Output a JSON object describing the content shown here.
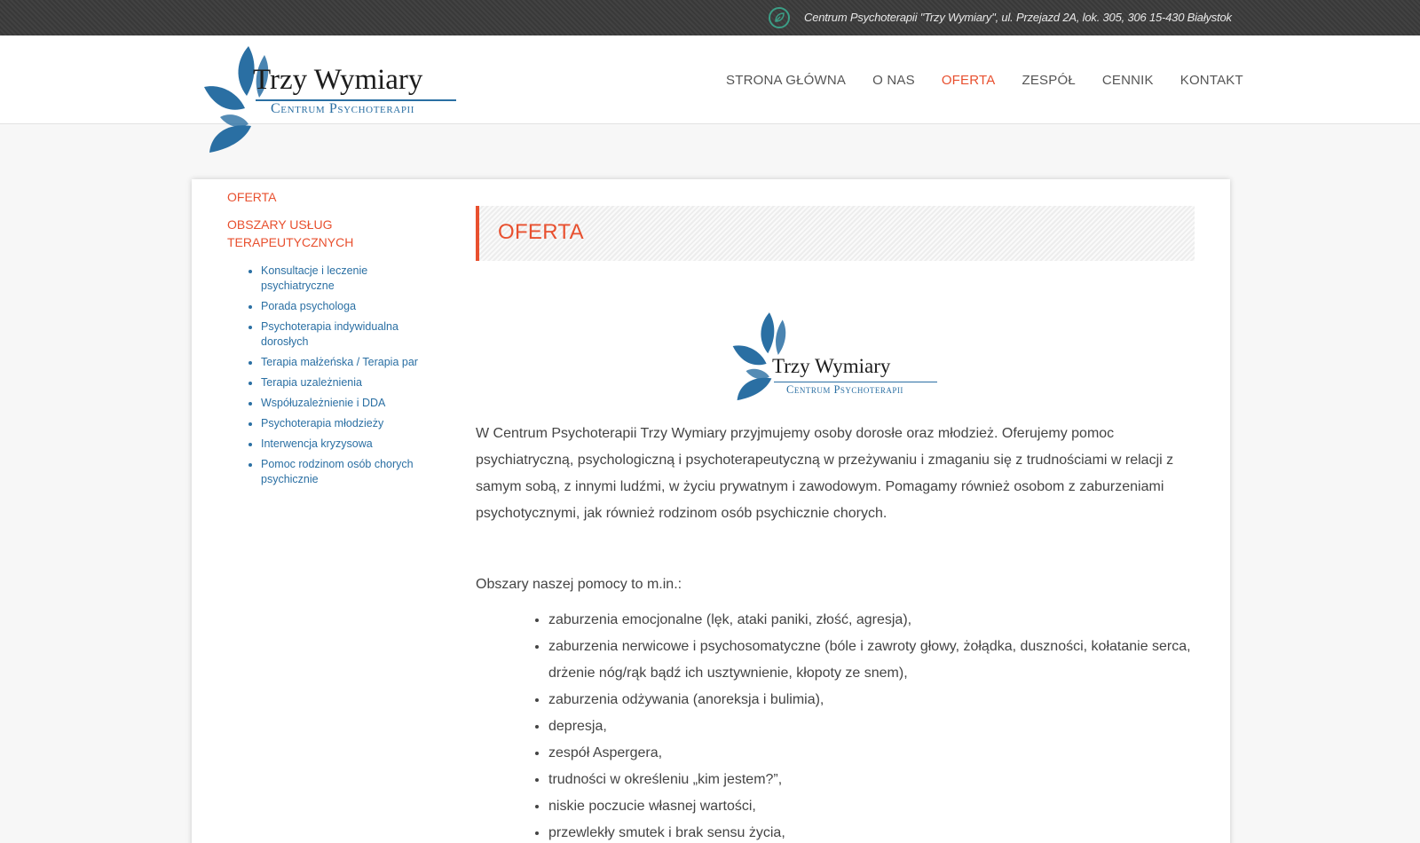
{
  "topbar": {
    "address": "Centrum Psychoterapii \"Trzy Wymiary\", ul. Przejazd 2A, lok. 305, 306 15-430 Białystok",
    "icon": "leaf-icon"
  },
  "logo": {
    "brand": "Trzy Wymiary",
    "subtitle": "Centrum Psychoterapii",
    "colors": {
      "leaf": "#2a6fa3",
      "text": "#1c1c1c"
    }
  },
  "nav": {
    "items": [
      {
        "label": "STRONA GŁÓWNA"
      },
      {
        "label": "O NAS"
      },
      {
        "label": "OFERTA",
        "active": true
      },
      {
        "label": "ZESPÓŁ"
      },
      {
        "label": "CENNIK"
      },
      {
        "label": "KONTAKT"
      }
    ],
    "active_color": "#e8502f"
  },
  "sidebar": {
    "title": "OFERTA",
    "subtitle": "OBSZARY USŁUG TERAPEUTYCZNYCH",
    "items": [
      {
        "label": "Konsultacje i leczenie psychiatryczne"
      },
      {
        "label": "Porada psychologa"
      },
      {
        "label": "Psychoterapia indywidualna dorosłych"
      },
      {
        "label": "Terapia małżeńska / Terapia par"
      },
      {
        "label": "Terapia uzależnienia"
      },
      {
        "label": "Współuzależnienie i DDA"
      },
      {
        "label": "Psychoterapia młodzieży"
      },
      {
        "label": "Interwencja kryzysowa"
      },
      {
        "label": "Pomoc rodzinom osób chorych psychicznie"
      }
    ]
  },
  "main": {
    "title": "OFERTA",
    "intro": "W Centrum Psychoterapii Trzy Wymiary przyjmujemy osoby dorosłe oraz młodzież. Oferujemy pomoc psychiatryczną, psychologiczną i psychoterapeutyczną w przeżywaniu i zmaganiu się z trudnościami w relacji z samym sobą, z innymi ludźmi, w życiu prywatnym i zawodowym. Pomagamy również osobom z zaburzeniami psychotycznymi, jak również rodzinom osób psychicznie chorych.",
    "areas_heading": "Obszary naszej pomocy to m.in.:",
    "areas": [
      "zaburzenia emocjonalne (lęk, ataki paniki, złość, agresja),",
      "zaburzenia nerwicowe i psychosomatyczne (bóle i zawroty głowy, żołądka, duszności, kołatanie serca, drżenie nóg/rąk bądź ich usztywnienie, kłopoty ze snem),",
      "zaburzenia odżywania (anoreksja i bulimia),",
      "depresja,",
      "zespół Aspergera,",
      "trudności w określeniu „kim jestem?”,",
      "niskie poczucie własnej wartości,",
      "przewlekły smutek i brak sensu życia,"
    ]
  }
}
